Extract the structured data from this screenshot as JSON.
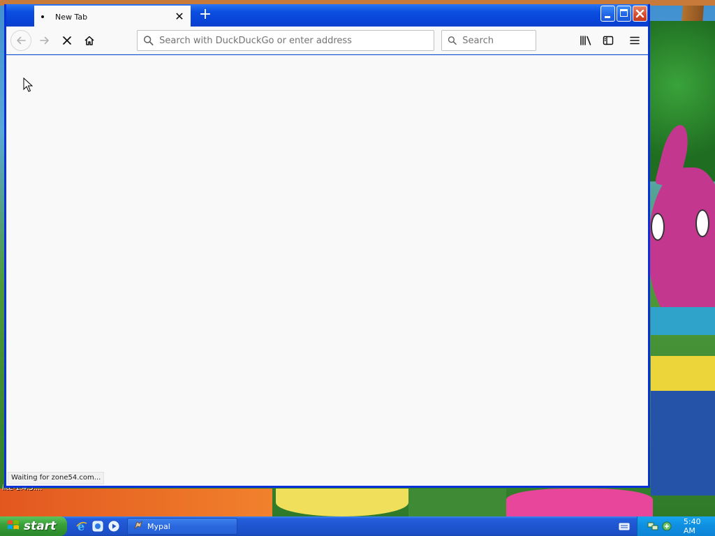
{
  "browser": {
    "tab": {
      "title": "New Tab",
      "close_glyph": "✕"
    },
    "new_tab_glyph": "+",
    "window_controls": {
      "minimize": "minimize-icon",
      "maximize": "maximize-icon",
      "close": "close-icon"
    },
    "toolbar": {
      "back": "back-arrow-icon",
      "forward": "forward-arrow-icon",
      "stop": "stop-loading-icon",
      "home": "home-icon",
      "address_placeholder": "Search with DuckDuckGo or enter address",
      "search_placeholder": "Search",
      "library": "library-icon",
      "sidebar": "sidebar-icon",
      "menu": "hamburger-menu-icon"
    },
    "status_text": "Waiting for zone54.com..."
  },
  "desktop": {
    "residual_text": "ilte-1.4.5...."
  },
  "taskbar": {
    "start_label": "start",
    "quick_launch": [
      "internet-explorer-icon",
      "browser-icon",
      "media-player-icon"
    ],
    "tasks": [
      {
        "label": "Mypal",
        "icon": "mypal-icon"
      }
    ],
    "clock": "5:40 AM"
  },
  "colors": {
    "titlebar": "#0a4ee0",
    "content_bg": "#f9f9fa",
    "taskbar": "#245edb",
    "start_button": "#3aa13a",
    "tray": "#0f8ee0"
  }
}
